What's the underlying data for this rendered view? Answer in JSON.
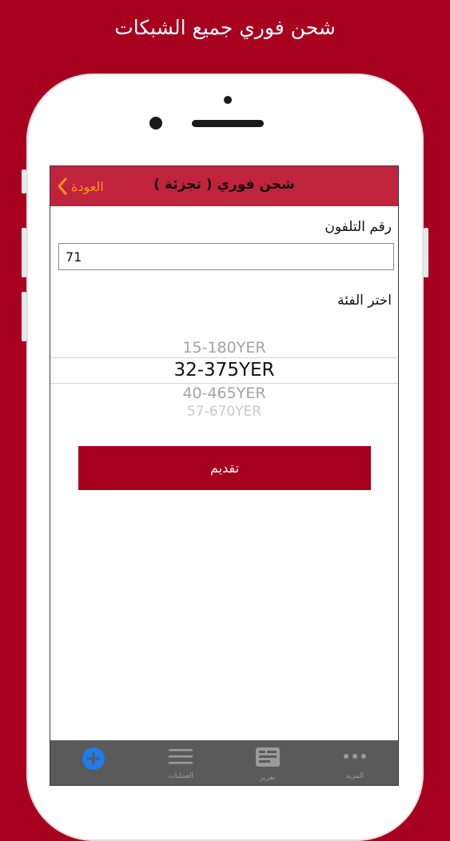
{
  "promo": {
    "title": "شحن فوري جميع الشبكات"
  },
  "navbar": {
    "title": "شحن فوري  (  تجزئة  )",
    "back_label": "العودة"
  },
  "form": {
    "phone_label": "رقم التلفون",
    "phone_value": "71",
    "category_label": "اختر الفئة",
    "picker_options": [
      "15-180YER",
      "32-375YER",
      "40-465YER",
      "57-670YER"
    ],
    "selected_option": "32-375YER",
    "submit_label": "تقديم"
  },
  "tabbar": {
    "items": [
      {
        "label": "",
        "icon": "plus-circle-icon",
        "active": true
      },
      {
        "label": "العمليات",
        "icon": "list-icon",
        "active": false
      },
      {
        "label": "تقرير",
        "icon": "report-icon",
        "active": false
      },
      {
        "label": "المزيد",
        "icon": "more-dots-icon",
        "active": false
      }
    ]
  },
  "colors": {
    "background": "#a8001f",
    "navbar": "#c0243d",
    "back_accent": "#f7941d",
    "tab_active": "#1e7cf0",
    "tabbar": "#5a5a5a"
  }
}
